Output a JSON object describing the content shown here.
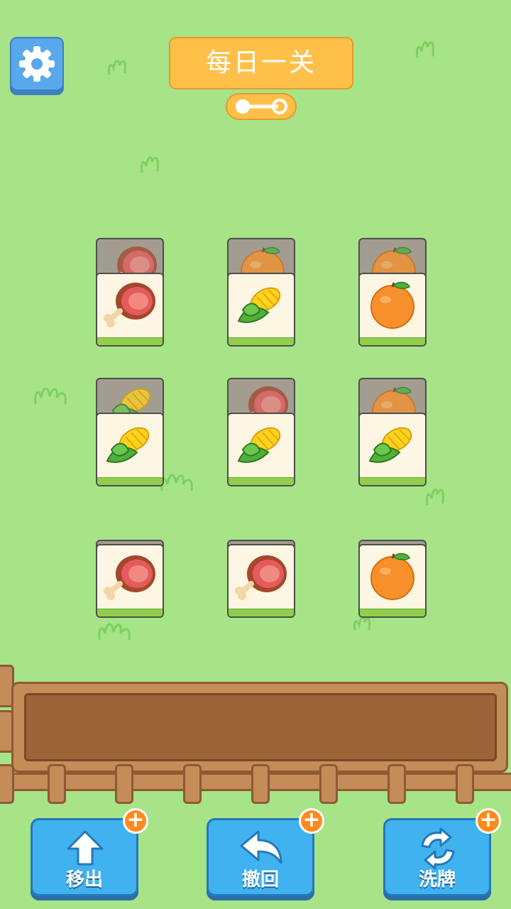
{
  "header": {
    "title": "每日一关",
    "settings_icon": "gear-icon",
    "progress_icon": "level-progress-icon"
  },
  "board": {
    "tiles": [
      {
        "row": 1,
        "col": 1,
        "top": "ham",
        "under": "ham"
      },
      {
        "row": 1,
        "col": 2,
        "top": "corn",
        "under": "orange"
      },
      {
        "row": 1,
        "col": 3,
        "top": "orange",
        "under": "orange"
      },
      {
        "row": 2,
        "col": 1,
        "top": "corn",
        "under": "corn"
      },
      {
        "row": 2,
        "col": 2,
        "top": "corn",
        "under": "ham"
      },
      {
        "row": 2,
        "col": 3,
        "top": "corn",
        "under": "orange"
      },
      {
        "row": 3,
        "col": 1,
        "top": "ham"
      },
      {
        "row": 3,
        "col": 2,
        "top": "ham"
      },
      {
        "row": 3,
        "col": 3,
        "top": "orange"
      }
    ]
  },
  "tray": {
    "slots_filled": 0
  },
  "toolbar": {
    "move_out_label": "移出",
    "undo_label": "撤回",
    "shuffle_label": "洗牌"
  },
  "colors": {
    "background": "#a6e487",
    "button_blue": "#3fb2ef",
    "title_orange": "#ffc04a",
    "plus_orange": "#ff8a1c"
  }
}
